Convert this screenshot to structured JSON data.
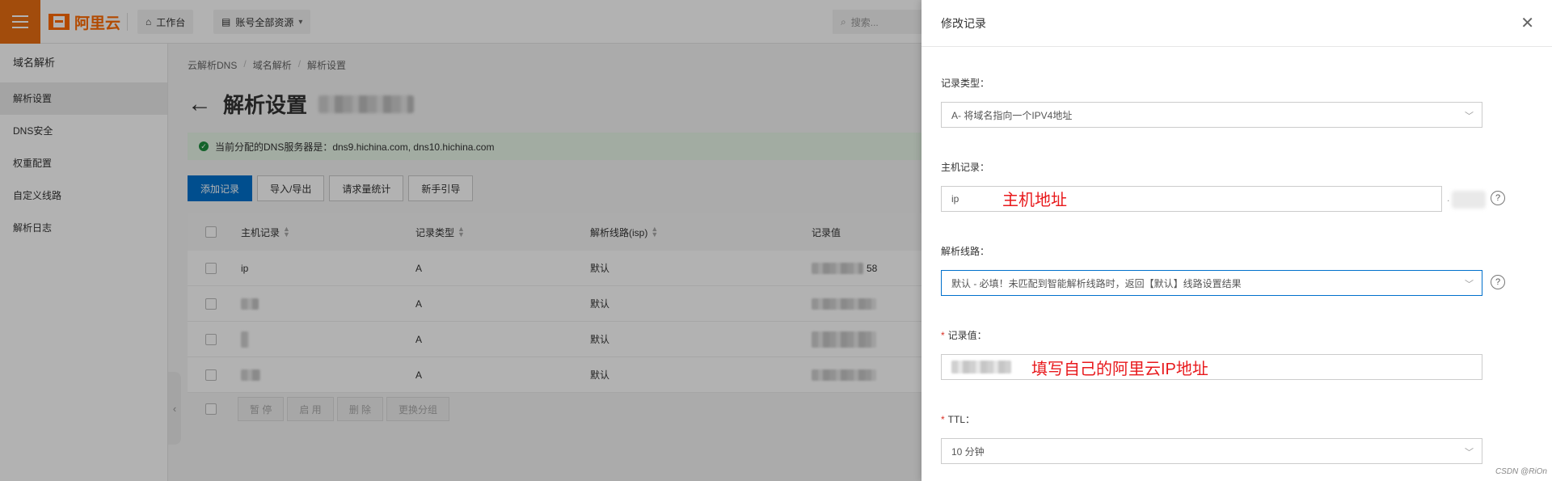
{
  "topbar": {
    "logo_text": "阿里云",
    "workbench": "工作台",
    "resources": "账号全部资源",
    "search_placeholder": "搜索..."
  },
  "sidebar": {
    "title": "域名解析",
    "items": [
      {
        "label": "解析设置",
        "active": true
      },
      {
        "label": "DNS安全",
        "active": false
      },
      {
        "label": "权重配置",
        "active": false
      },
      {
        "label": "自定义线路",
        "active": false
      },
      {
        "label": "解析日志",
        "active": false
      }
    ]
  },
  "main": {
    "breadcrumb": [
      "云解析DNS",
      "域名解析",
      "解析设置"
    ],
    "title": "解析设置",
    "alert": "当前分配的DNS服务器是：dns9.hichina.com, dns10.hichina.com",
    "toolbar": {
      "add": "添加记录",
      "import_export": "导入/导出",
      "stats": "请求量统计",
      "guide": "新手引导"
    },
    "table": {
      "headers": [
        "主机记录",
        "记录类型",
        "解析线路(isp)",
        "记录值"
      ],
      "rows": [
        {
          "host": "ip",
          "type": "A",
          "line": "默认",
          "value": "58"
        },
        {
          "host": "",
          "type": "A",
          "line": "默认",
          "value": ""
        },
        {
          "host": "",
          "type": "A",
          "line": "默认",
          "value": ""
        },
        {
          "host": "",
          "type": "A",
          "line": "默认",
          "value": ""
        }
      ]
    },
    "bulk": {
      "pause": "暂 停",
      "enable": "启 用",
      "delete": "删 除",
      "change_group": "更换分组"
    }
  },
  "drawer": {
    "title": "修改记录",
    "record_type_label": "记录类型：",
    "record_type_value": "A- 将域名指向一个IPV4地址",
    "host_label": "主机记录：",
    "host_value": "ip",
    "host_annotation": "主机地址",
    "line_label": "解析线路：",
    "line_value": "默认 - 必填！未匹配到智能解析线路时，返回【默认】线路设置结果",
    "value_label": "记录值：",
    "value_annotation": "填写自己的阿里云IP地址",
    "ttl_label": "TTL：",
    "ttl_value": "10 分钟"
  },
  "watermark": "CSDN @RiOn",
  "colors": {
    "brand": "#ff6a00",
    "primary": "#0070cc",
    "annotation": "#e8191c"
  }
}
